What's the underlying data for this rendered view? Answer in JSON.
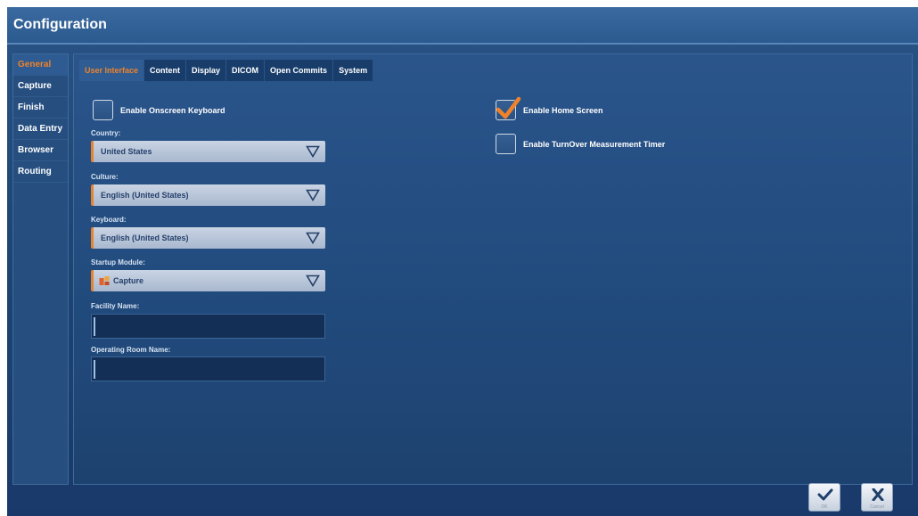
{
  "window": {
    "title": "Configuration"
  },
  "sidebar": {
    "items": [
      {
        "label": "General",
        "active": true
      },
      {
        "label": "Capture"
      },
      {
        "label": "Finish"
      },
      {
        "label": "Data Entry"
      },
      {
        "label": "Browser"
      },
      {
        "label": "Routing"
      }
    ]
  },
  "tabs": [
    {
      "label": "User Interface",
      "active": true
    },
    {
      "label": "Content"
    },
    {
      "label": "Display"
    },
    {
      "label": "DICOM"
    },
    {
      "label": "Open Commits"
    },
    {
      "label": "System"
    }
  ],
  "form": {
    "onscreen_keyboard": {
      "label": "Enable Onscreen Keyboard",
      "checked": false
    },
    "home_screen": {
      "label": "Enable Home Screen",
      "checked": true
    },
    "turnover_timer": {
      "label": "Enable TurnOver Measurement Timer",
      "checked": false
    },
    "country": {
      "label": "Country:",
      "value": "United States"
    },
    "culture": {
      "label": "Culture:",
      "value": "English (United States)"
    },
    "keyboard": {
      "label": "Keyboard:",
      "value": "English (United States)"
    },
    "startup_module": {
      "label": "Startup Module:",
      "value": "Capture",
      "icon": "capture-module-icon"
    },
    "facility_name": {
      "label": "Facility Name:",
      "value": ""
    },
    "operating_room_name": {
      "label": "Operating Room Name:",
      "value": ""
    }
  },
  "footer": {
    "ok_label": "OK",
    "cancel_label": "Cancel"
  },
  "colors": {
    "accent": "#f0822a",
    "background": "#1f4775",
    "field": "#142f55",
    "dropdown": "#bac7da"
  }
}
